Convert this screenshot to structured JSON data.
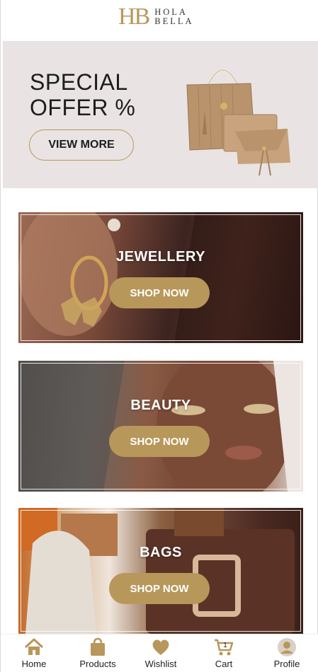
{
  "header": {
    "logo_mark": "HB",
    "logo_line1": "HOLA",
    "logo_line2": "BELLA"
  },
  "hero": {
    "title_line1": "SPECIAL",
    "title_line2": "OFFER %",
    "button_label": "VIEW MORE"
  },
  "categories": [
    {
      "title": "JEWELLERY",
      "button_label": "SHOP NOW"
    },
    {
      "title": "BEAUTY",
      "button_label": "SHOP NOW"
    },
    {
      "title": "BAGS",
      "button_label": "SHOP NOW"
    }
  ],
  "nav": {
    "items": [
      {
        "label": "Home",
        "icon": "home-icon"
      },
      {
        "label": "Products",
        "icon": "shopping-bag-icon"
      },
      {
        "label": "Wishlist",
        "icon": "heart-icon"
      },
      {
        "label": "Cart",
        "icon": "cart-icon",
        "badge": "1"
      },
      {
        "label": "Profile",
        "icon": "user-icon"
      }
    ]
  },
  "colors": {
    "accent": "#b8975a",
    "hero_bg": "#e9e3e3",
    "text": "#1d1d1d"
  }
}
